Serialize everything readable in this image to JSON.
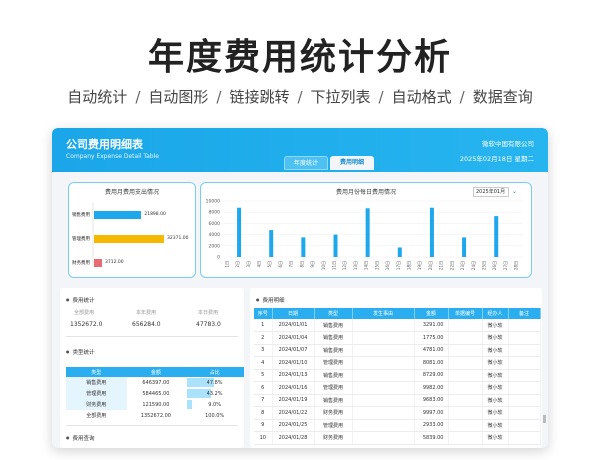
{
  "hero": {
    "title": "年度费用统计分析",
    "features": [
      "自动统计",
      "自动图形",
      "链接跳转",
      "下拉列表",
      "自动格式",
      "数据查询"
    ],
    "separator": "/"
  },
  "window": {
    "title": "公司费用明细表",
    "subtitle": "Company Expense Detail Table",
    "company": "微软中国有限公司",
    "date": "2025年02月18日  星期二",
    "tabs": [
      {
        "label": "年度统计",
        "active": false
      },
      {
        "label": "费用明细",
        "active": true
      }
    ]
  },
  "type_chart": {
    "title": "费用月费用支出情况",
    "bars": [
      {
        "label": "销售费用",
        "value": "21898.00",
        "amount": 21898,
        "color": "#1ea8ec"
      },
      {
        "label": "管理费用",
        "value": "32371.00",
        "amount": 32371,
        "color": "#f5b800"
      },
      {
        "label": "财务费用",
        "value": "3712.00",
        "amount": 3712,
        "color": "#e86a75"
      }
    ]
  },
  "chart_data": {
    "type": "bar",
    "title": "费用月份每日费用情况",
    "categories": [
      "1日",
      "2日",
      "3日",
      "4日",
      "5日",
      "6日",
      "7日",
      "8日",
      "9日",
      "10日",
      "11日",
      "12日",
      "13日",
      "14日",
      "15日",
      "16日",
      "17日",
      "18日",
      "19日",
      "20日",
      "21日",
      "22日",
      "23日",
      "24日",
      "25日",
      "26日",
      "27日",
      "28日"
    ],
    "values": [
      0,
      8800,
      0,
      0,
      4800,
      0,
      0,
      3500,
      0,
      0,
      4000,
      0,
      0,
      8700,
      0,
      0,
      1700,
      0,
      0,
      8800,
      0,
      0,
      3500,
      0,
      0,
      7300,
      0,
      0
    ],
    "yticks": [
      "10000",
      "8000",
      "6000",
      "4000",
      "2000",
      "0"
    ],
    "ylim": [
      0,
      10000
    ],
    "month_select": "2025年01月",
    "color": "#1ea8ec"
  },
  "stats": {
    "title": "费用统计",
    "headers": [
      "全部费用",
      "本年费用",
      "本日费用"
    ],
    "values": [
      "1352672.0",
      "656284.0",
      "47783.0"
    ]
  },
  "type_stats": {
    "title": "类型统计",
    "headers": [
      "类型",
      "金额",
      "占比"
    ],
    "rows": [
      {
        "type": "销售费用",
        "amount": "646397.00",
        "pct": "47.8%",
        "ratio": 0.478
      },
      {
        "type": "管理费用",
        "amount": "584465.00",
        "pct": "43.2%",
        "ratio": 0.432
      },
      {
        "type": "财务费用",
        "amount": "121590.00",
        "pct": "9.0%",
        "ratio": 0.09
      },
      {
        "type": "全部费用",
        "amount": "1352672.00",
        "pct": "100.0%",
        "ratio": 0
      }
    ]
  },
  "query": {
    "title": "费用查询"
  },
  "detail": {
    "title": "费用明细",
    "headers": [
      "序号",
      "日期",
      "类型",
      "发生事由",
      "金额",
      "单据编号",
      "经办人",
      "备注"
    ],
    "rows": [
      [
        "1",
        "2024/01/01",
        "销售费用",
        "",
        "3291.00",
        "",
        "微小软",
        ""
      ],
      [
        "2",
        "2024/01/04",
        "销售费用",
        "",
        "1775.00",
        "",
        "微小软",
        ""
      ],
      [
        "3",
        "2024/01/07",
        "销售费用",
        "",
        "4781.00",
        "",
        "微小软",
        ""
      ],
      [
        "4",
        "2024/01/10",
        "管理费用",
        "",
        "8081.00",
        "",
        "微小软",
        ""
      ],
      [
        "5",
        "2024/01/13",
        "销售费用",
        "",
        "8729.00",
        "",
        "微小软",
        ""
      ],
      [
        "6",
        "2024/01/16",
        "管理费用",
        "",
        "9982.00",
        "",
        "微小软",
        ""
      ],
      [
        "7",
        "2024/01/19",
        "销售费用",
        "",
        "9683.00",
        "",
        "微小软",
        ""
      ],
      [
        "8",
        "2024/01/22",
        "财务费用",
        "",
        "9997.00",
        "",
        "微小软",
        ""
      ],
      [
        "9",
        "2024/01/25",
        "管理费用",
        "",
        "2933.00",
        "",
        "微小软",
        ""
      ],
      [
        "10",
        "2024/01/28",
        "财务费用",
        "",
        "5839.00",
        "",
        "微小软",
        ""
      ]
    ]
  }
}
